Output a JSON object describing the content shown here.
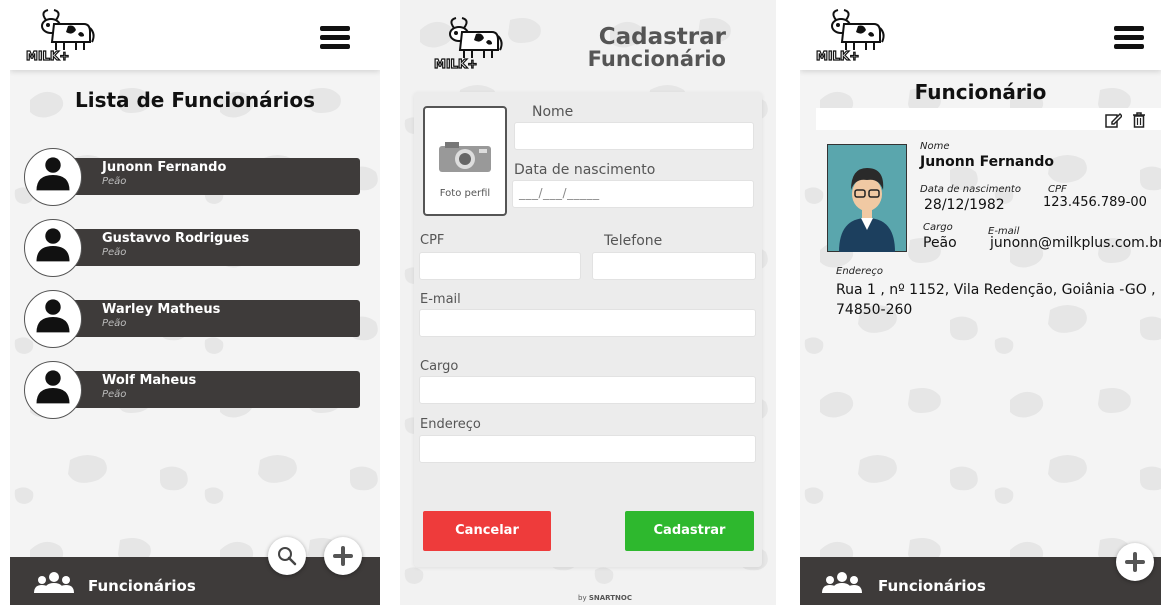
{
  "list_screen": {
    "title": "Lista de Funcionários",
    "employees": [
      {
        "name": "Junonn Fernando",
        "role": "Peão"
      },
      {
        "name": "Gustavvo Rodrigues",
        "role": "Peão"
      },
      {
        "name": "Warley Matheus",
        "role": "Peão"
      },
      {
        "name": "Wolf Maheus",
        "role": "Peão"
      }
    ],
    "footer_label": "Funcionários",
    "search_icon": "search-icon",
    "add_icon": "plus-icon"
  },
  "form_screen": {
    "title_line1": "Cadastrar",
    "title_line2": "Funcionário",
    "photo_label": "Foto perfil",
    "fields": {
      "nome": "Nome",
      "data_nascimento": "Data de nascimento",
      "data_placeholder": "___/___/_____",
      "cpf": "CPF",
      "telefone": "Telefone",
      "email": "E-mail",
      "cargo": "Cargo",
      "endereco": "Endereço"
    },
    "cancel_label": "Cancelar",
    "submit_label": "Cadastrar",
    "credit_prefix": "by",
    "credit_brand": "SNARTNOC"
  },
  "detail_screen": {
    "title": "Funcionário",
    "nome_label": "Nome",
    "nome": "Junonn Fernando",
    "nascimento_label": "Data de nascimento",
    "nascimento": "28/12/1982",
    "cpf_label": "CPF",
    "cpf": "123.456.789-00",
    "cargo_label": "Cargo",
    "cargo": "Peão",
    "email_label": "E-mail",
    "email": "junonn@milkplus.com.br",
    "endereco_label": "Endereço",
    "endereco_line1": "Rua 1 , nº 1152, Vila Redenção, Goiânia -GO ,",
    "endereco_line2": "74850-260",
    "footer_label": "Funcionários"
  },
  "brand": {
    "logo_text": "MILK+",
    "colors": {
      "dark_bar": "#3e3b3a",
      "cancel": "#ee3b3b",
      "submit": "#2eb82e",
      "photo_bg": "#5aa6ad",
      "background": "#f4f4f4"
    }
  }
}
